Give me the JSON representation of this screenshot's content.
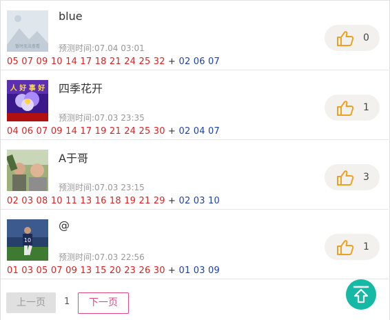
{
  "items": [
    {
      "name": "blue",
      "time": "预测时间:07.04 03:01",
      "red": "05 07 09 10 14 17 18 21 24 25 32",
      "plus": "+",
      "blue": "02 06 07",
      "likes": "0",
      "avatar_text": "暂时无法查看"
    },
    {
      "name": "四季花开",
      "time": "预测时间:07.03 23:35",
      "red": "04 06 07 09 14 17 19 21 24 25 30",
      "plus": "+",
      "blue": "02 04 07",
      "likes": "1",
      "avatar_text": "人 好 事 好"
    },
    {
      "name": "A于哥",
      "time": "预测时间:07.03 23:15",
      "red": "02 03 08 10 11 13 16 18 19 21 29",
      "plus": "+",
      "blue": "02 03 10",
      "likes": "3"
    },
    {
      "name": "@",
      "time": "预测时间:07.03 22:56",
      "red": "01 03 05 07 09 13 15 20 23 26 30",
      "plus": "+",
      "blue": "01 03 09",
      "likes": "1"
    }
  ],
  "pager": {
    "prev": "上一页",
    "page": "1",
    "next": "下一页"
  },
  "colors": {
    "red_ball": "#e02020",
    "blue_ball": "#1a3fb5",
    "like_icon": "#f0a020",
    "back_to_top": "#16b9a6",
    "next_border": "#e8457a"
  }
}
